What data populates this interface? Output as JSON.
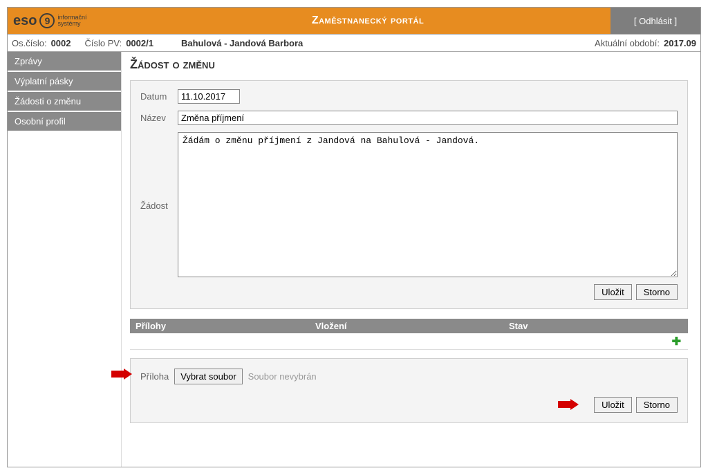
{
  "header": {
    "logo_text": "eso",
    "logo_num": "9",
    "logo_sub1": "informační",
    "logo_sub2": "systémy",
    "title": "Zaměstnanecký portál",
    "logout": "[ Odhlásit ]"
  },
  "infobar": {
    "os_cislo_label": "Os.číslo:",
    "os_cislo_value": "0002",
    "cislo_pv_label": "Číslo PV:",
    "cislo_pv_value": "0002/1",
    "name": "Bahulová - Jandová Barbora",
    "period_label": "Aktuální období:",
    "period_value": "2017.09"
  },
  "sidebar": {
    "items": [
      {
        "label": "Zprávy"
      },
      {
        "label": "Výplatní pásky"
      },
      {
        "label": "Žádosti o změnu"
      },
      {
        "label": "Osobní profil"
      }
    ]
  },
  "main": {
    "title": "Žádost o změnu",
    "form": {
      "date_label": "Datum",
      "date_value": "11.10.2017",
      "name_label": "Název",
      "name_value": "Změna příjmení",
      "request_label": "Žádost",
      "request_value": "Žádám o změnu příjmení z Jandová na Bahulová - Jandová.",
      "save_label": "Uložit",
      "cancel_label": "Storno"
    },
    "attachments": {
      "col1": "Přílohy",
      "col2": "Vložení",
      "col3": "Stav",
      "attach_label": "Příloha",
      "file_button": "Vybrat soubor",
      "file_status": "Soubor nevybrán",
      "save_label": "Uložit",
      "cancel_label": "Storno"
    }
  }
}
